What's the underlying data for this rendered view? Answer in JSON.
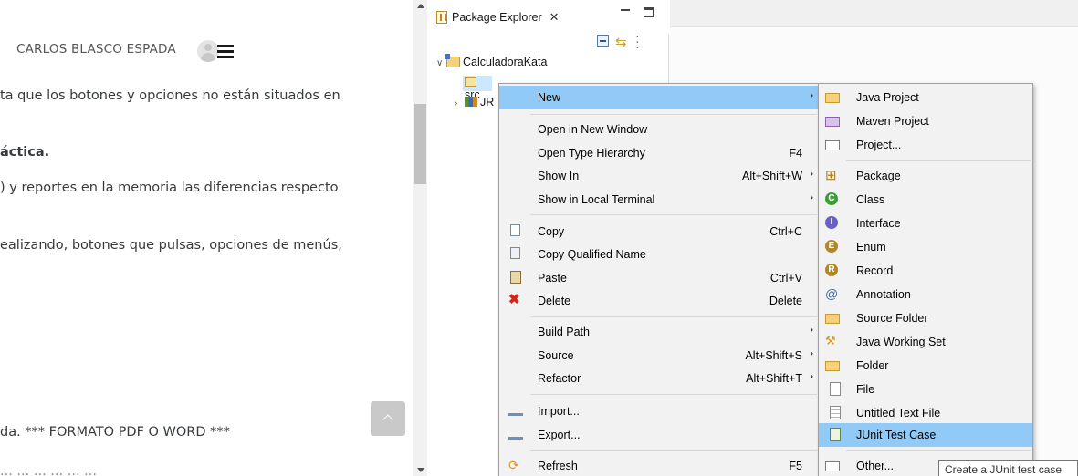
{
  "browser": {
    "user_name": "CARLOS BLASCO ESPADA",
    "lines": [
      "ta que los botones y opciones no están situados en",
      "áctica.",
      ") y reportes en la memoria las diferencias respecto",
      "ealizando, botones que pulsas, opciones de menús,",
      "da. *** FORMATO PDF O WORD ***",
      "... ... ... ... ... ..."
    ]
  },
  "eclipse": {
    "view_tab": "Package Explorer",
    "tree": {
      "project": "CalculadoraKata",
      "src": "src",
      "jre": "JR"
    }
  },
  "context_menu": {
    "items": [
      {
        "label": "New",
        "accel": "",
        "submenu": true,
        "highlight": true
      },
      {
        "label": "Open in New Window",
        "accel": ""
      },
      {
        "label": "Open Type Hierarchy",
        "accel": "F4"
      },
      {
        "label": "Show In",
        "accel": "Alt+Shift+W",
        "submenu": true
      },
      {
        "label": "Show in Local Terminal",
        "accel": "",
        "submenu": true
      },
      {
        "label": "Copy",
        "accel": "Ctrl+C"
      },
      {
        "label": "Copy Qualified Name",
        "accel": ""
      },
      {
        "label": "Paste",
        "accel": "Ctrl+V"
      },
      {
        "label": "Delete",
        "accel": "Delete"
      },
      {
        "label": "Build Path",
        "accel": "",
        "submenu": true
      },
      {
        "label": "Source",
        "accel": "Alt+Shift+S",
        "submenu": true
      },
      {
        "label": "Refactor",
        "accel": "Alt+Shift+T",
        "submenu": true
      },
      {
        "label": "Import...",
        "accel": ""
      },
      {
        "label": "Export...",
        "accel": ""
      },
      {
        "label": "Refresh",
        "accel": "F5"
      }
    ]
  },
  "new_submenu": {
    "items": [
      "Java Project",
      "Maven Project",
      "Project...",
      "Package",
      "Class",
      "Interface",
      "Enum",
      "Record",
      "Annotation",
      "Source Folder",
      "Java Working Set",
      "Folder",
      "File",
      "Untitled Text File",
      "JUnit Test Case",
      "Other..."
    ],
    "highlighted": "JUnit Test Case"
  },
  "tooltip": "Create a JUnit test case",
  "colors": {
    "menu_bg": "#f2f2f2",
    "highlight": "#91c9f7",
    "selection": "#cce8ff"
  }
}
